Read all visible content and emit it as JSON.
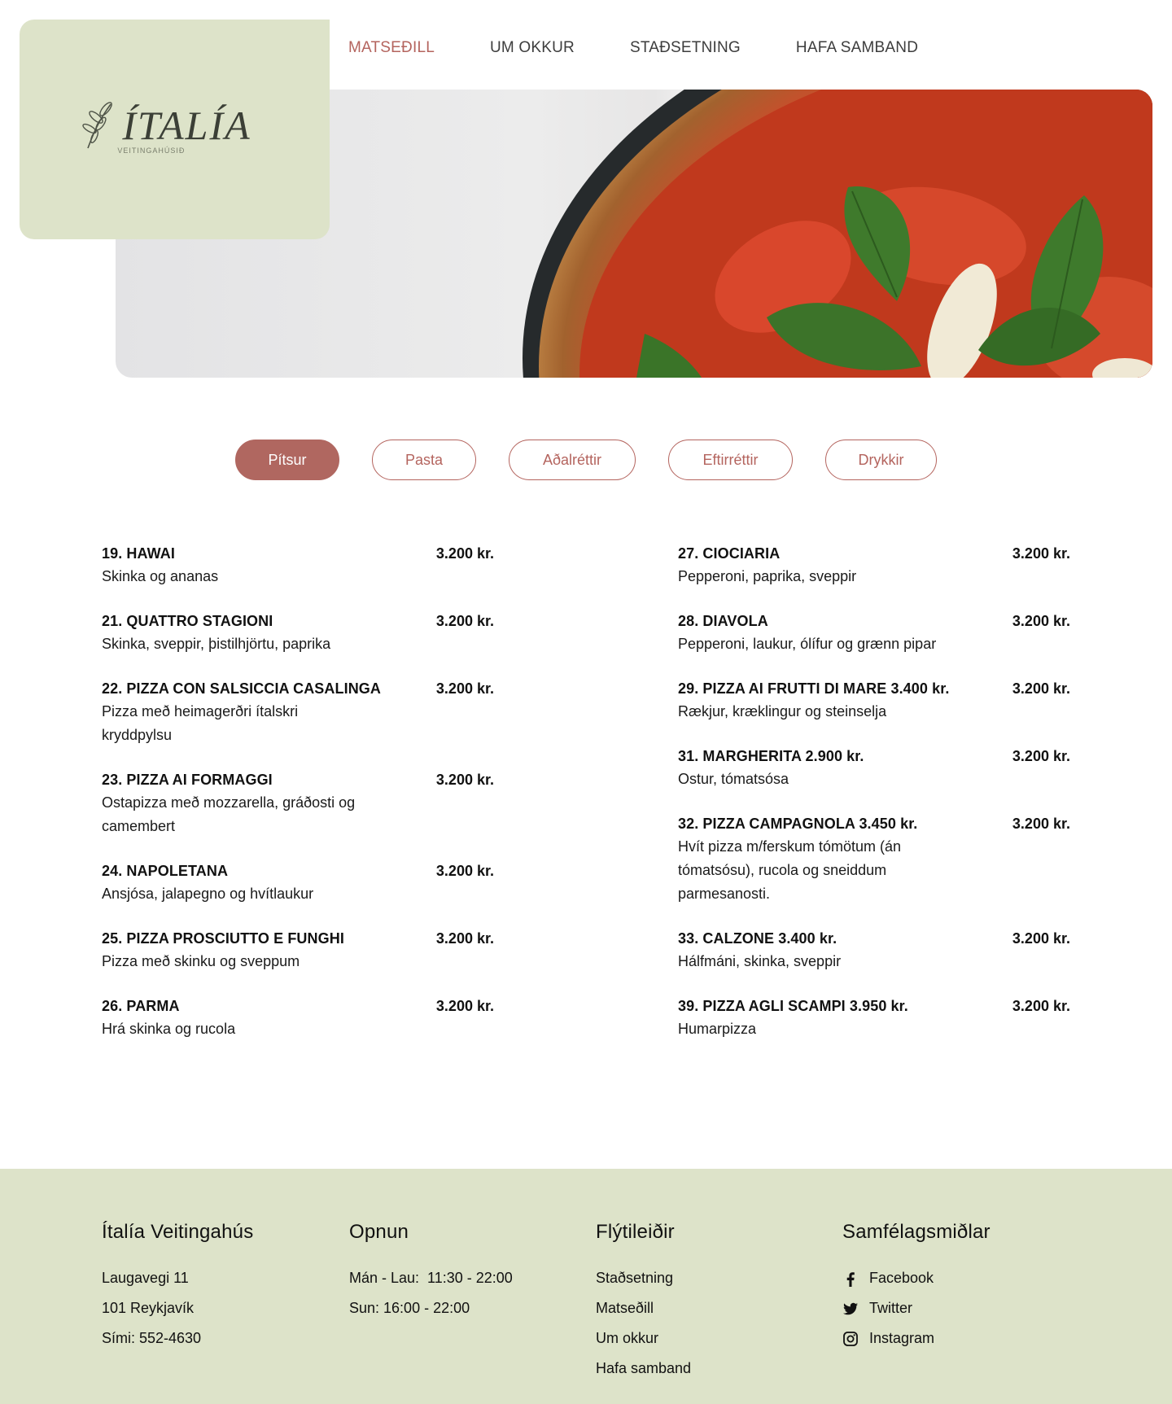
{
  "brand": {
    "logo_title": "ÍTALÍA",
    "logo_subtitle": "VEITINGAHÚSIÐ"
  },
  "nav": {
    "items": [
      {
        "label": "MATSEÐILL",
        "active": true
      },
      {
        "label": "UM OKKUR",
        "active": false
      },
      {
        "label": "STAÐSETNING",
        "active": false
      },
      {
        "label": "HAFA SAMBAND",
        "active": false
      }
    ]
  },
  "tabs": [
    {
      "label": "Pítsur",
      "active": true
    },
    {
      "label": "Pasta",
      "active": false
    },
    {
      "label": "Aðalréttir",
      "active": false
    },
    {
      "label": "Eftirréttir",
      "active": false
    },
    {
      "label": "Drykkir",
      "active": false
    }
  ],
  "menu": {
    "left": [
      {
        "name": "19. HAWAI",
        "price": "3.200 kr.",
        "desc": "Skinka og ananas"
      },
      {
        "name": "21. QUATTRO STAGIONI",
        "price": "3.200 kr.",
        "desc": "Skinka, sveppir, þistilhjörtu, paprika"
      },
      {
        "name": "22. PIZZA CON SALSICCIA CASALINGA",
        "price": "3.200 kr.",
        "desc": "Pizza með heimagerðri ítalskri kryddpylsu"
      },
      {
        "name": "23. PIZZA AI FORMAGGI",
        "price": "3.200 kr.",
        "desc": "Ostapizza með mozzarella, gráðosti og camembert"
      },
      {
        "name": "24. NAPOLETANA",
        "price": "3.200 kr.",
        "desc": "Ansjósa, jalapegno og hvítlaukur"
      },
      {
        "name": "25. PIZZA PROSCIUTTO E FUNGHI",
        "price": "3.200 kr.",
        "desc": "Pizza með skinku og sveppum"
      },
      {
        "name": "26. PARMA",
        "price": "3.200 kr.",
        "desc": "Hrá skinka og rucola"
      }
    ],
    "right": [
      {
        "name": "27. CIOCIARIA",
        "price": "3.200 kr.",
        "desc": "Pepperoni, paprika, sveppir"
      },
      {
        "name": "28. DIAVOLA",
        "price": "3.200 kr.",
        "desc": "Pepperoni, laukur, ólífur og grænn pipar"
      },
      {
        "name": "29. PIZZA AI FRUTTI DI MARE 3.400 kr.",
        "price": "3.200 kr.",
        "desc": "Rækjur, kræklingur og steinselja"
      },
      {
        "name": "31. MARGHERITA 2.900 kr.",
        "price": "3.200 kr.",
        "desc": "Ostur, tómatsósa"
      },
      {
        "name": "32. PIZZA CAMPAGNOLA 3.450 kr.",
        "price": "3.200 kr.",
        "desc": "Hvít pizza m/ferskum tómötum (án tómatsósu), rucola og sneiddum parmesanosti."
      },
      {
        "name": "33. CALZONE 3.400 kr.",
        "price": "3.200 kr.",
        "desc": "Hálfmáni, skinka, sveppir"
      },
      {
        "name": "39. PIZZA AGLI SCAMPI 3.950 kr.",
        "price": "3.200 kr.",
        "desc": "Humarpizza"
      }
    ]
  },
  "footer": {
    "about": {
      "title": "Ítalía Veitingahús",
      "lines": [
        "Laugavegi 11",
        "101 Reykjavík",
        "Sími: 552-4630"
      ]
    },
    "hours": {
      "title": "Opnun",
      "lines": [
        "Mán - Lau:  11:30 - 22:00",
        "Sun: 16:00 - 22:00"
      ]
    },
    "links": {
      "title": "Flýtileiðir",
      "items": [
        "Staðsetning",
        "Matseðill",
        "Um okkur",
        "Hafa samband"
      ]
    },
    "social": {
      "title": "Samfélagsmiðlar",
      "items": [
        {
          "label": "Facebook",
          "icon": "facebook-icon"
        },
        {
          "label": "Twitter",
          "icon": "twitter-icon"
        },
        {
          "label": "Instagram",
          "icon": "instagram-icon"
        }
      ]
    }
  },
  "colors": {
    "accent": "#b06760",
    "sage": "#dde3c9",
    "text": "#111111"
  }
}
